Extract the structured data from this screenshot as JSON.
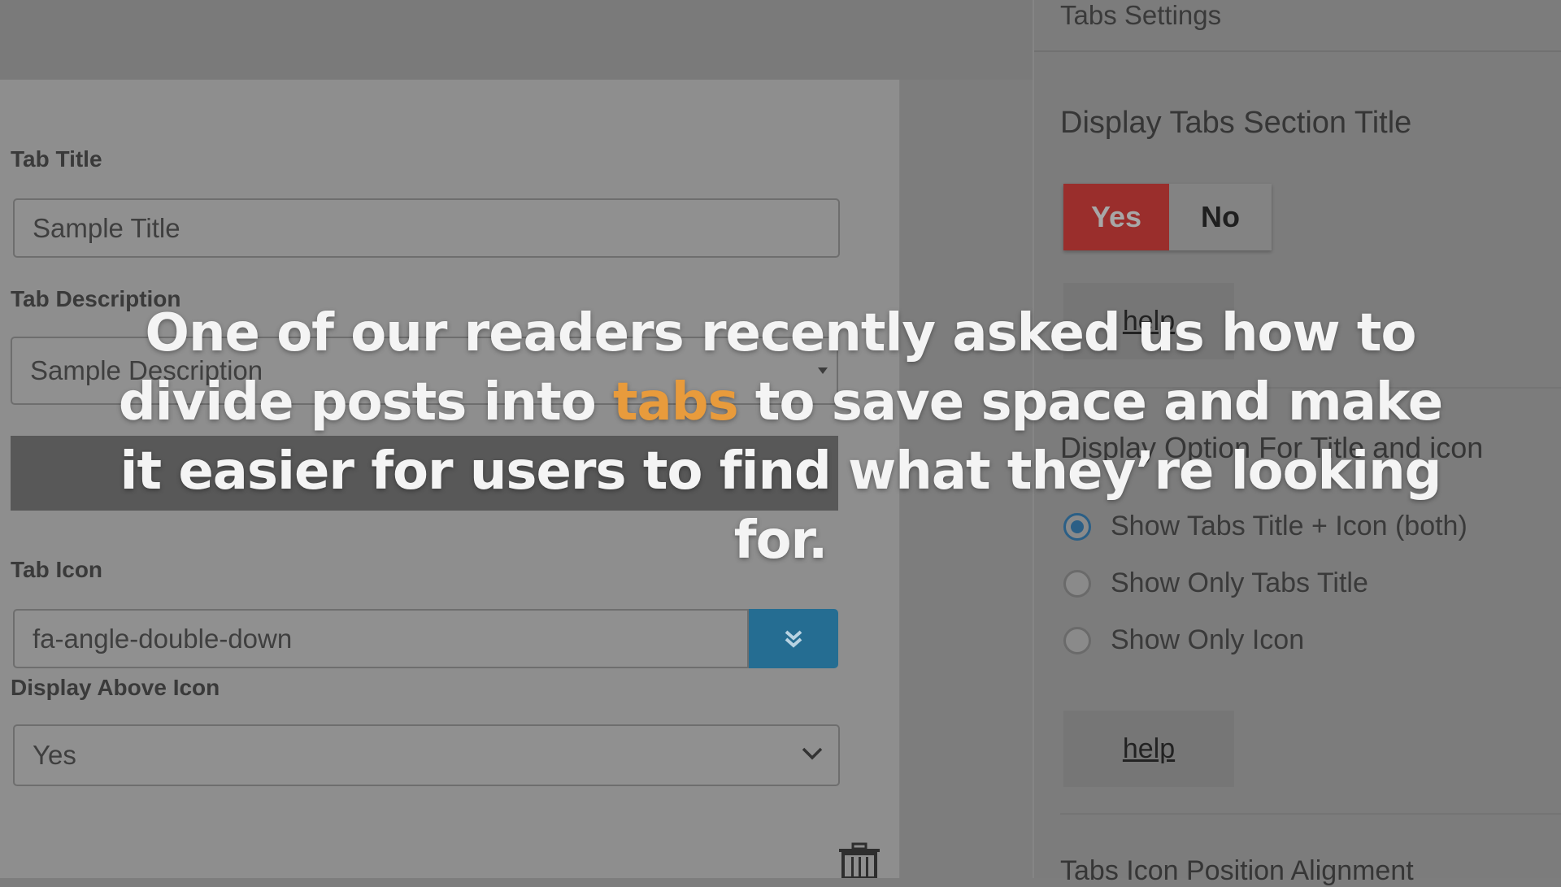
{
  "left_form": {
    "tab_title_label": "Tab Title",
    "tab_title_placeholder": "Sample Title",
    "tab_description_label": "Tab Description",
    "tab_description_placeholder": "Sample Description",
    "tab_icon_label": "Tab Icon",
    "tab_icon_value": "fa-angle-double-down",
    "display_above_icon_label": "Display Above Icon",
    "display_above_icon_value": "Yes"
  },
  "right_panel": {
    "title": "Tabs Settings",
    "display_title_heading": "Display Tabs Section Title",
    "toggle_yes": "Yes",
    "toggle_no": "No",
    "help_label": "help",
    "display_option_heading": "Display Option For Title and icon",
    "radio_options": [
      {
        "label": "Show Tabs Title + Icon (both)",
        "selected": true
      },
      {
        "label": "Show Only Tabs Title",
        "selected": false
      },
      {
        "label": "Show Only Icon",
        "selected": false
      }
    ],
    "icon_position_heading": "Tabs Icon Position Alignment"
  },
  "caption": {
    "line1": "One of our readers recently asked us how to",
    "line2_pre": "divide posts into ",
    "line2_highlight": "tabs",
    "line2_post": " to save space and make",
    "line3": "it easier for users to find what they’re looking",
    "line4": "for."
  },
  "colors": {
    "toggle_active": "#9a2e2c",
    "icon_button": "#256d92",
    "caption_highlight": "#e89b3c",
    "caption_text": "#f4f4f4"
  }
}
